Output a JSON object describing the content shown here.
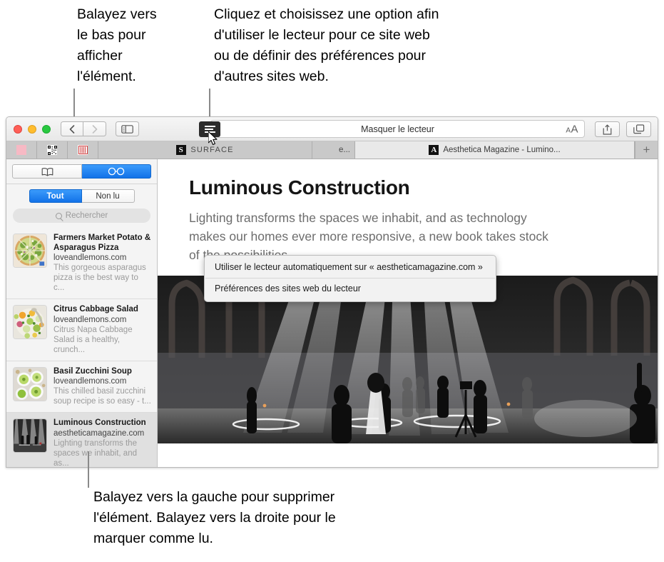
{
  "callouts": {
    "top_left": "Balayez vers\nle bas pour\nafficher\nl'élément.",
    "top_right": "Cliquez et choisissez une option afin\nd'utiliser le lecteur pour ce site web\nou de définir des préférences pour\nd'autres sites web.",
    "bottom": "Balayez vers la gauche pour supprimer\nl'élément. Balayez vers la droite pour le\nmarquer comme lu."
  },
  "toolbar": {
    "back_icon": "chevron-left-icon",
    "forward_icon": "chevron-right-icon",
    "sidebar_icon": "sidebar-icon",
    "reader_icon": "reader-icon",
    "add_bookmark_icon": "plus-circle-icon",
    "address_text": "Masquer le lecteur",
    "font_size_small": "A",
    "font_size_big": "A",
    "share_icon": "share-icon",
    "tab_overview_icon": "tab-overview-icon"
  },
  "reader_menu": {
    "items": [
      "Utiliser le lecteur automatiquement sur « aestheticamagazine.com »",
      "Préférences des sites web du lecteur"
    ]
  },
  "tabs": {
    "mini": [
      {
        "favicon": "pink-favicon"
      },
      {
        "favicon": "qr-favicon"
      },
      {
        "favicon": "red-book-favicon"
      }
    ],
    "surface": {
      "favicon": "surface-s-favicon",
      "label": "SURFACE"
    },
    "truncated": {
      "label": "e..."
    },
    "active": {
      "favicon": "aesthetica-a-favicon",
      "label": "Aesthetica Magazine - Lumino..."
    },
    "new_tab_label": "+"
  },
  "sidebar": {
    "segments": [
      {
        "icon": "bookmarks-book-icon",
        "selected": false
      },
      {
        "icon": "reading-list-glasses-icon",
        "selected": true
      }
    ],
    "filters": [
      {
        "label": "Tout",
        "selected": true
      },
      {
        "label": "Non lu",
        "selected": false
      }
    ],
    "search": {
      "placeholder": "Rechercher",
      "value": "",
      "icon": "search-icon"
    },
    "reading_list": [
      {
        "title": "Farmers Market Potato & Asparagus Pizza",
        "site": "loveandlemons.com",
        "snippet": "This gorgeous asparagus pizza is the best way to c...",
        "thumb": "pizza-thumb",
        "selected": false
      },
      {
        "title": "Citrus Cabbage Salad",
        "site": "loveandlemons.com",
        "snippet": "Citrus Napa Cabbage Salad is a healthy, crunch...",
        "thumb": "salad-thumb",
        "selected": false
      },
      {
        "title": "Basil Zucchini Soup",
        "site": "loveandlemons.com",
        "snippet": "This chilled basil zucchini soup recipe is so easy - t...",
        "thumb": "soup-thumb",
        "selected": false
      },
      {
        "title": "Luminous Construction",
        "site": "aestheticamagazine.com",
        "snippet": "Lighting transforms the spaces we inhabit, and as...",
        "thumb": "installation-thumb",
        "selected": true
      }
    ]
  },
  "article": {
    "title": "Luminous Construction",
    "lede": "Lighting transforms the spaces we inhabit, and as technology makes our homes ever more responsive, a new book takes stock of the possibilities.",
    "hero_alt": "light-installation-photo"
  },
  "colors": {
    "accent_blue": "#1272e8",
    "tabbar_gray": "#c9c9c9",
    "sidebar_gray": "#f4f4f4",
    "selected_row": "#e0e0e0"
  }
}
